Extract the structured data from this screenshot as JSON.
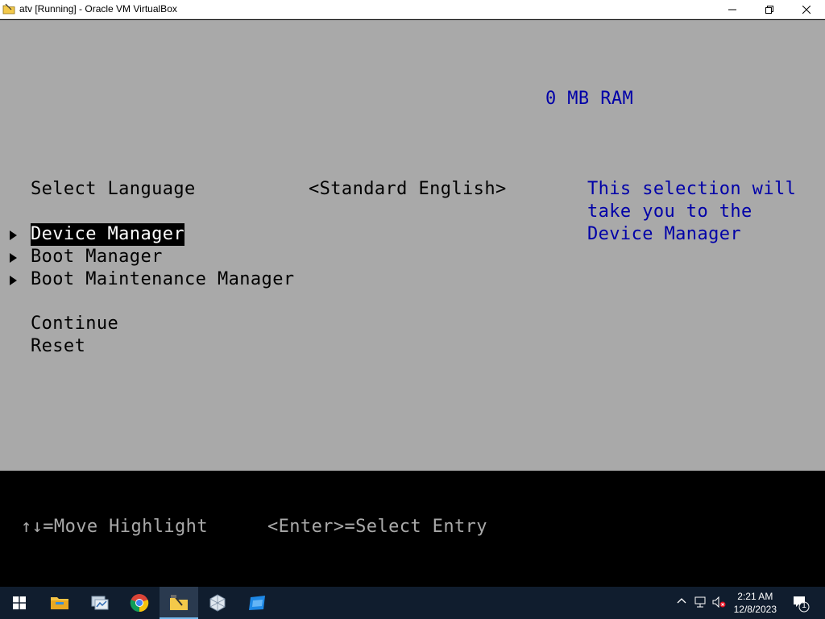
{
  "window": {
    "title": "atv [Running] - Oracle VM VirtualBox",
    "icon": "virtualbox-folder-icon",
    "controls": [
      "minimize-icon",
      "restore-icon",
      "close-icon"
    ]
  },
  "bios": {
    "ram_text": "0 MB RAM",
    "select_language_label": "Select Language",
    "select_language_value": "<Standard English>",
    "help_lines": [
      "This selection will",
      "take you to the",
      "Device Manager"
    ],
    "menu_items": [
      {
        "label": "Device Manager",
        "selected": true
      },
      {
        "label": "Boot Manager",
        "selected": false
      },
      {
        "label": "Boot Maintenance Manager",
        "selected": false
      }
    ],
    "actions": [
      {
        "label": "Continue"
      },
      {
        "label": "Reset"
      }
    ],
    "footer": {
      "move_hint": "↑↓=Move Highlight",
      "select_hint": "<Enter>=Select Entry"
    },
    "colors": {
      "background": "#a9a9a9",
      "accent_blue": "#0000a8",
      "highlight_bg": "#000000",
      "highlight_fg": "#ffffff"
    }
  },
  "taskbar": {
    "apps": [
      {
        "name": "start-icon"
      },
      {
        "name": "file-explorer-icon"
      },
      {
        "name": "network-tool-icon"
      },
      {
        "name": "chrome-icon"
      },
      {
        "name": "folder-app-icon",
        "active": true
      },
      {
        "name": "virtualbox-icon"
      },
      {
        "name": "blue-app-icon"
      }
    ],
    "tray": {
      "time": "2:21 AM",
      "date": "12/8/2023",
      "notification_count": "1"
    }
  }
}
